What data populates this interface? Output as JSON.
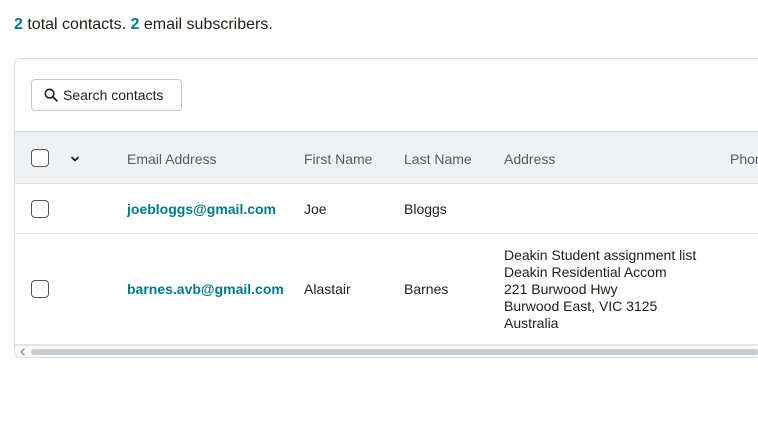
{
  "summary": {
    "total_count": "2",
    "total_label": " total contacts. ",
    "subscriber_count": "2",
    "subscriber_label": " email subscribers."
  },
  "search": {
    "label": "Search contacts",
    "icon": "search-icon"
  },
  "table": {
    "columns": [
      "Email Address",
      "First Name",
      "Last Name",
      "Address",
      "Phone"
    ],
    "rows": [
      {
        "email": "joebloggs@gmail.com",
        "first_name": "Joe",
        "last_name": "Bloggs",
        "address": []
      },
      {
        "email": "barnes.avb@gmail.com",
        "first_name": "Alastair",
        "last_name": "Barnes",
        "address": [
          "Deakin Student assignment list",
          "Deakin Residential Accom",
          "221 Burwood Hwy",
          "Burwood East, VIC 3125",
          "Australia"
        ]
      }
    ]
  },
  "colors": {
    "accent": "#007c89",
    "header_bg": "#eff2f4",
    "text": "#241c15"
  }
}
